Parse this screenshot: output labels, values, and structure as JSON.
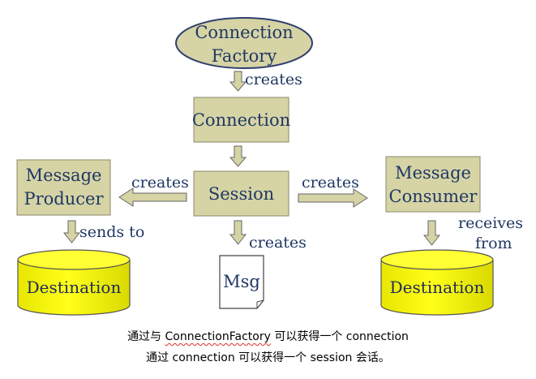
{
  "diagram": {
    "colors": {
      "box_fill": "#D6D3A5",
      "box_stroke": "#8A8A6A",
      "cylinder_fill": "#FFFF00",
      "cylinder_stroke": "#555555",
      "arrow_fill": "#D6D3A5",
      "text": "#1F3864"
    },
    "nodes": {
      "connection_factory": [
        "Connection",
        "Factory"
      ],
      "connection": "Connection",
      "session": "Session",
      "message_producer": [
        "Message",
        "Producer"
      ],
      "message_consumer": [
        "Message",
        "Consumer"
      ],
      "destination_left": "Destination",
      "destination_right": "Destination",
      "msg": "Msg"
    },
    "edges": {
      "factory_to_connection": "creates",
      "session_to_producer": "creates",
      "session_to_consumer": "creates",
      "producer_to_destination": "sends to",
      "destination_to_consumer": [
        "receives",
        "from"
      ],
      "session_to_msg": "creates"
    }
  },
  "caption": {
    "line1_prefix": "通过与 ",
    "line1_highlight": "ConnectionFactory",
    "line1_suffix": " 可以获得一个 connection",
    "line2": "通过 connection 可以获得一个 session 会话。"
  }
}
